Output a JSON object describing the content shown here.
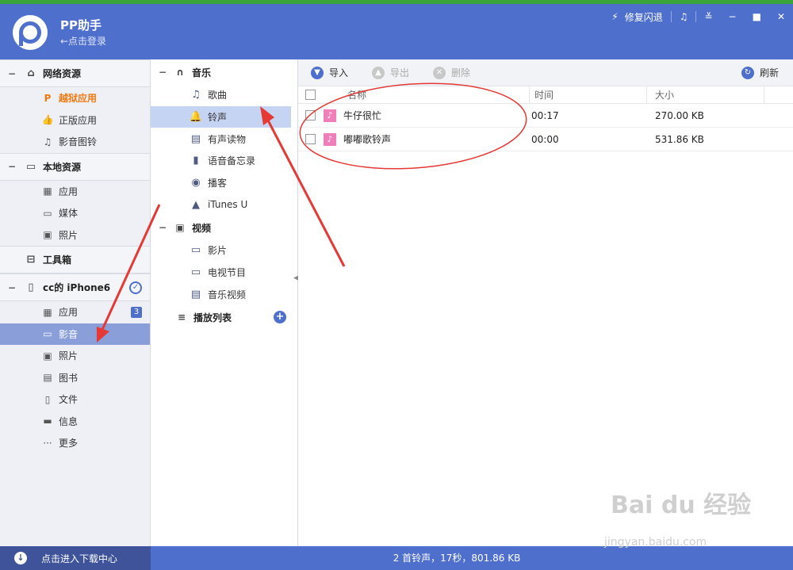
{
  "app": {
    "title": "PP助手",
    "login_hint": "←点击登录",
    "repair": "修复闪退"
  },
  "sidebar": {
    "groups": [
      {
        "label": "网络资源",
        "items": [
          {
            "label": "越狱应用",
            "icon": "pp-icon"
          },
          {
            "label": "正版应用",
            "icon": "thumb-icon"
          },
          {
            "label": "影音图铃",
            "icon": "music-note-icon"
          }
        ]
      },
      {
        "label": "本地资源",
        "items": [
          {
            "label": "应用",
            "icon": "grid-icon"
          },
          {
            "label": "媒体",
            "icon": "video-icon"
          },
          {
            "label": "照片",
            "icon": "photo-icon"
          }
        ]
      },
      {
        "label": "工具箱"
      },
      {
        "label": "cc的 iPhone6",
        "items": [
          {
            "label": "应用",
            "icon": "grid-icon",
            "badge": "3"
          },
          {
            "label": "影音",
            "icon": "video-icon"
          },
          {
            "label": "照片",
            "icon": "photo-icon"
          },
          {
            "label": "图书",
            "icon": "book-icon"
          },
          {
            "label": "文件",
            "icon": "file-icon"
          },
          {
            "label": "信息",
            "icon": "message-icon"
          },
          {
            "label": "更多",
            "icon": "more-icon"
          }
        ]
      }
    ]
  },
  "media_nav": {
    "music": {
      "label": "音乐",
      "items": [
        "歌曲",
        "铃声",
        "有声读物",
        "语音备忘录",
        "播客",
        "iTunes U"
      ]
    },
    "video": {
      "label": "视频",
      "items": [
        "影片",
        "电视节目",
        "音乐视频"
      ]
    },
    "playlist": {
      "label": "播放列表"
    }
  },
  "toolbar": {
    "import": "导入",
    "export": "导出",
    "delete": "删除",
    "refresh": "刷新"
  },
  "table": {
    "columns": [
      "名称",
      "时间",
      "大小"
    ],
    "rows": [
      {
        "name": "牛仔很忙",
        "time": "00:17",
        "size": "270.00 KB"
      },
      {
        "name": "嘟嘟歌铃声",
        "time": "00:00",
        "size": "531.86 KB"
      }
    ]
  },
  "status": {
    "download_center": "点击进入下载中心",
    "summary": "2 首铃声，17秒，801.86 KB"
  },
  "colors": {
    "brand": "#4f6fcd",
    "active_item": "#8a9ed9",
    "accent_orange": "#f07a10",
    "annotation_red": "#e53935"
  }
}
